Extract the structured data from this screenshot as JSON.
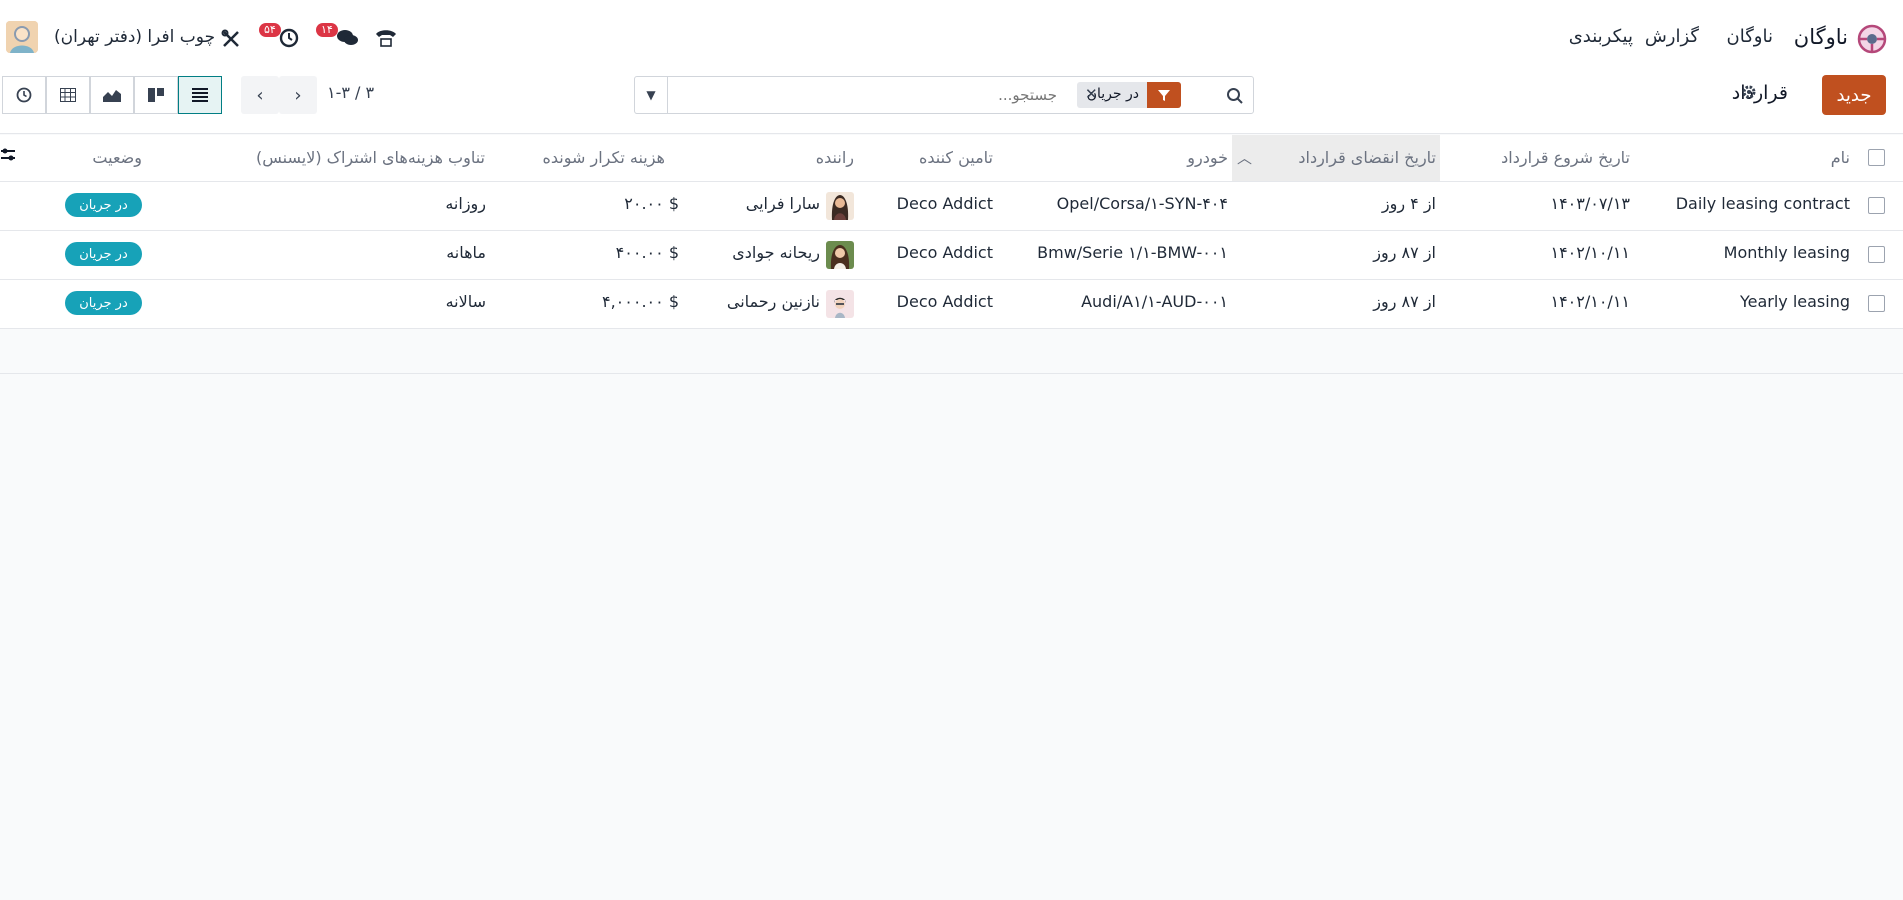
{
  "topbar": {
    "brand": "ناوگان",
    "menu": [
      "ناوگان",
      "گزارش",
      "پیکربندی"
    ],
    "company": "چوب افرا (دفتر تهران)",
    "messages_badge": "۱۴",
    "activities_badge": "۵۴",
    "icons": [
      "steering-wheel-icon",
      "phone-icon",
      "chat-icon",
      "clock-icon",
      "tools-icon",
      "avatar"
    ]
  },
  "control": {
    "new_label": "جدید",
    "breadcrumb": "قرارداد",
    "facet_label": "در جریان",
    "search_placeholder": "جستجو...",
    "pager": "۱-۳ / ۳"
  },
  "table": {
    "columns": [
      "نام",
      "تاریخ شروع قرارداد",
      "تاریخ انقضای قرارداد",
      "خودرو",
      "تامین کننده",
      "راننده",
      "هزینه تکرار شونده",
      "تناوب هزینه‌های اشتراک (لایسنس)",
      "وضعیت"
    ],
    "rows": [
      {
        "name": "Daily leasing contract",
        "start": "۱۴۰۳/۰۷/۱۳",
        "expiry": "از ۴ روز",
        "vehicle": "Opel/Corsa/۱-SYN-۴۰۴",
        "vendor": "Deco Addict",
        "driver": "سارا فرایی",
        "cost": "۲۰.۰۰ $",
        "frequency": "روزانه",
        "status": "در جریان"
      },
      {
        "name": "Monthly leasing",
        "start": "۱۴۰۲/۱۰/۱۱",
        "expiry": "از ۸۷ روز",
        "vehicle": "Bmw/Serie ۱/۱-BMW-۰۰۱",
        "vendor": "Deco Addict",
        "driver": "ریحانه جوادی",
        "cost": "۴۰۰.۰۰ $",
        "frequency": "ماهانه",
        "status": "در جریان"
      },
      {
        "name": "Yearly leasing",
        "start": "۱۴۰۲/۱۰/۱۱",
        "expiry": "از ۸۷ روز",
        "vehicle": "Audi/A۱/۱-AUD-۰۰۱",
        "vendor": "Deco Addict",
        "driver": "نازنین رحمانی",
        "cost": "۴,۰۰۰.۰۰ $",
        "frequency": "سالانه",
        "status": "در جریان"
      }
    ]
  },
  "colors": {
    "primary": "#c0501f",
    "status": "#17a2b8",
    "badge": "#dc3545",
    "accent": "#017e84"
  }
}
